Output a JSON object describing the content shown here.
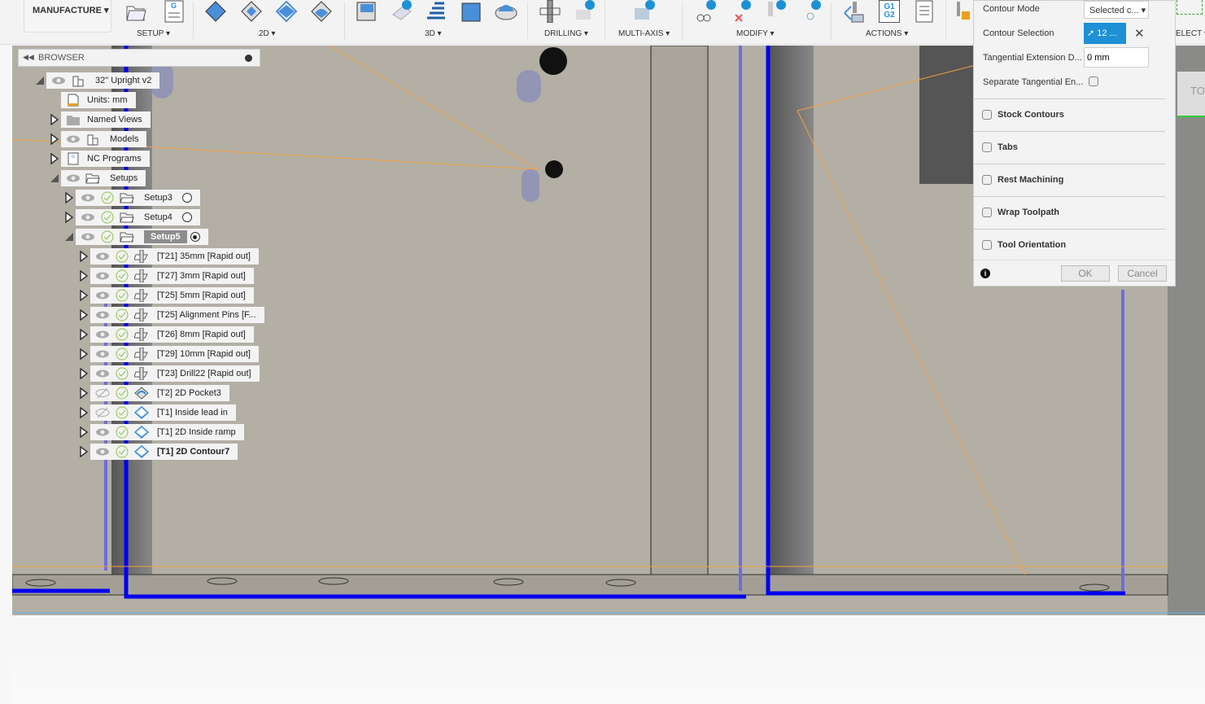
{
  "toolbar": {
    "workspace": "MANUFACTURE",
    "groups": [
      "SETUP ▾",
      "2D ▾",
      "3D ▾",
      "DRILLING ▾",
      "MULTI-AXIS ▾",
      "MODIFY ▾",
      "ACTIONS ▾",
      "ELECT ▾"
    ],
    "gcode_icon_text": "G1\nG2"
  },
  "browser": {
    "title": "BROWSER",
    "root": "32\" Upright v2",
    "units": "Units: mm",
    "named_views": "Named Views",
    "models": "Models",
    "nc_programs": "NC Programs",
    "setups": "Setups",
    "setup_list": [
      "Setup3",
      "Setup4",
      "Setup5"
    ],
    "operations": [
      {
        "label": "[T21] 35mm [Rapid out]",
        "type": "drill",
        "visible": true
      },
      {
        "label": "[T27] 3mm [Rapid out]",
        "type": "drill",
        "visible": true
      },
      {
        "label": "[T25] 5mm [Rapid out]",
        "type": "drill",
        "visible": true
      },
      {
        "label": "[T25] Alignment Pins [F...",
        "type": "drill",
        "visible": true
      },
      {
        "label": "[T26] 8mm [Rapid out]",
        "type": "drill",
        "visible": true
      },
      {
        "label": "[T29] 10mm [Rapid out]",
        "type": "drill",
        "visible": true
      },
      {
        "label": "[T23] Drill22 [Rapid out]",
        "type": "drill",
        "visible": true
      },
      {
        "label": "[T2] 2D Pocket3",
        "type": "pocket",
        "visible": false
      },
      {
        "label": "[T1] Inside lead in",
        "type": "contour",
        "visible": false
      },
      {
        "label": "[T1] 2D Inside ramp",
        "type": "contour",
        "visible": true
      },
      {
        "label": "[T1] 2D Contour7",
        "type": "contour",
        "visible": true,
        "active": true
      }
    ]
  },
  "dialog": {
    "contour_mode_label": "Contour Mode",
    "contour_mode_value": "Selected c...",
    "contour_selection_label": "Contour Selection",
    "contour_selection_value": "12 ...",
    "tangential_ext_label": "Tangential Extension D...",
    "tangential_ext_value": "0 mm",
    "separate_tangential_label": "Separate Tangential En...",
    "sections": [
      "Stock Contours",
      "Tabs",
      "Rest Machining",
      "Wrap Toolpath",
      "Tool Orientation"
    ],
    "ok": "OK",
    "cancel": "Cancel",
    "accent": "#1e90d6"
  },
  "side": {
    "partial_button": "TO"
  }
}
